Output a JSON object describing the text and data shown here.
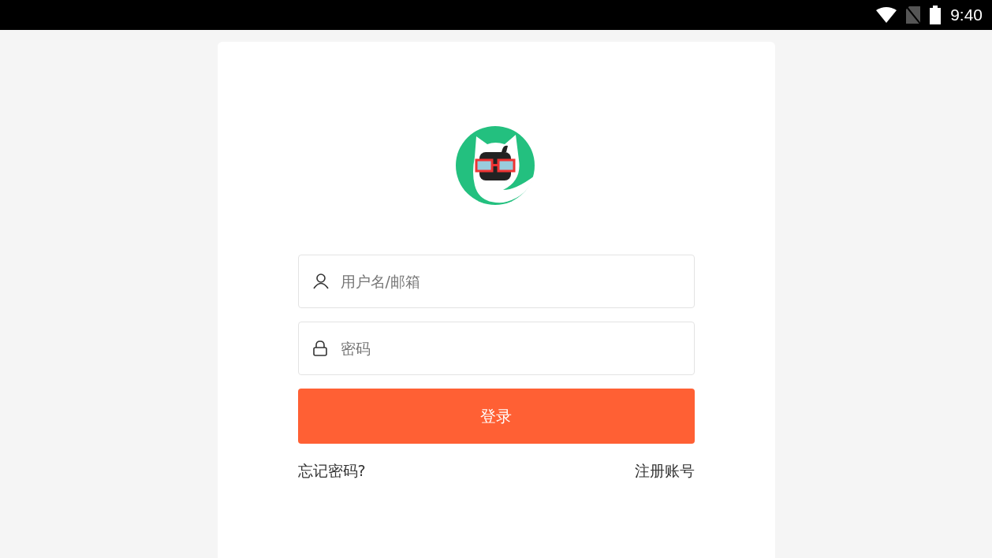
{
  "status_bar": {
    "time": "9:40"
  },
  "fields": [
    {
      "kind": "user",
      "placeholder": "用户名/邮箱"
    },
    {
      "kind": "password",
      "placeholder": "密码"
    }
  ],
  "login_button": "登录",
  "links": {
    "forgot": "忘记密码?",
    "register": "注册账号"
  }
}
